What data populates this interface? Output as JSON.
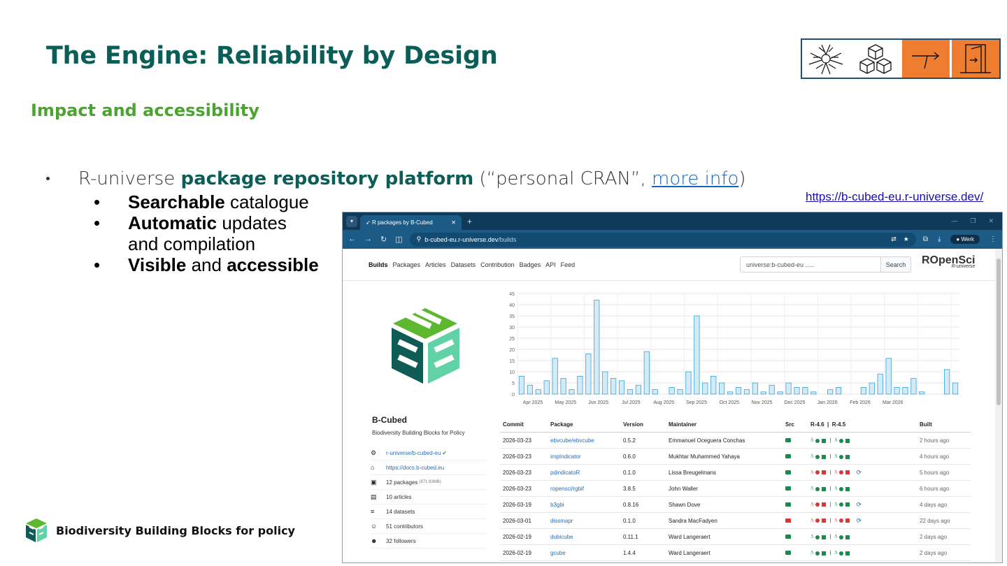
{
  "slide": {
    "title": "The Engine: Reliability by Design",
    "subtitle": "Impact and accessibility",
    "bullet_prefix": "R-universe ",
    "bullet_bold": "package repository platform",
    "bullet_mid": " (“personal CRAN”, ",
    "bullet_link": "more info",
    "bullet_suffix": ")",
    "sub_bullets": [
      {
        "bold": "Searchable",
        "rest": " catalogue"
      },
      {
        "bold": "Automatic",
        "rest": " updates"
      },
      {
        "bold": "",
        "rest": "and compilation"
      },
      {
        "bold": "Visible",
        "rest": " and ",
        "bold2": "accessible"
      }
    ],
    "url": "https://b-cubed-eu.r-universe.dev/",
    "footer": "Biodiversity Building Blocks for policy"
  },
  "browser": {
    "tab_title": "R packages by B-Cubed",
    "url_host": "b-cubed-eu.r-universe.dev",
    "url_path": "/builds",
    "profile": "Werk",
    "nav": [
      "Builds",
      "Packages",
      "Articles",
      "Datasets",
      "Contribution",
      "Badges",
      "API",
      "Feed"
    ],
    "search_value": "universe:b-cubed-eu .....",
    "search_button": "Search",
    "brand": "ROpenSci",
    "brand_sub": "R-universe"
  },
  "profile": {
    "name": "B-Cubed",
    "description": "Biodiversity Building Blocks for Policy",
    "items": [
      {
        "icon": "github-icon",
        "glyph": "⚙",
        "text": "r-universe/b-cubed-eu",
        "extra": "✔",
        "link": true
      },
      {
        "icon": "home-icon",
        "glyph": "⌂",
        "text": "https://docs.b-cubed.eu",
        "link": true
      },
      {
        "icon": "packages-icon",
        "glyph": "▣",
        "text": "12 packages",
        "small": "(871.93MB)"
      },
      {
        "icon": "articles-icon",
        "glyph": "▤",
        "text": "10 articles"
      },
      {
        "icon": "datasets-icon",
        "glyph": "≡",
        "text": "14 datasets"
      },
      {
        "icon": "contributors-icon",
        "glyph": "☺",
        "text": "51 contributors"
      },
      {
        "icon": "followers-icon",
        "glyph": "☻",
        "text": "32 followers"
      }
    ]
  },
  "chart_data": {
    "type": "bar",
    "ylim": [
      0,
      45
    ],
    "yticks": [
      0,
      5,
      10,
      15,
      20,
      25,
      30,
      35,
      40,
      45
    ],
    "xtick_labels": [
      "Apr 2025",
      "May 2025",
      "Jun 2025",
      "Jul 2025",
      "Aug 2025",
      "Sep 2025",
      "Oct 2025",
      "Nov 2025",
      "Dec 2025",
      "Jan 2026",
      "Feb 2026",
      "Mar 2026"
    ],
    "values": [
      8,
      4,
      2,
      6,
      16,
      7,
      2,
      8,
      18,
      42,
      10,
      7,
      6,
      2,
      4,
      19,
      2,
      0,
      3,
      2,
      10,
      35,
      5,
      8,
      5,
      1,
      3,
      2,
      5,
      1,
      4,
      1,
      5,
      3,
      3,
      1,
      0,
      2,
      3,
      0,
      0,
      3,
      5,
      9,
      16,
      3,
      3,
      7,
      1,
      0,
      0,
      11,
      5
    ],
    "color": "#d3ebf7",
    "stroke": "#3aa0d5",
    "grid": true
  },
  "builds": {
    "headers": [
      "Commit",
      "Package",
      "Version",
      "Maintainer",
      "Src",
      "R-4.6  |  R-4.5",
      "Built"
    ],
    "rows": [
      {
        "commit": "2026-03-23",
        "package": "ebvcube/ebvcube",
        "version": "0.5.2",
        "maintainer": "Emmanuel Oceguera Conchas",
        "built": "2 hours ago",
        "src_fail": false,
        "fail": false,
        "sync": false
      },
      {
        "commit": "2026-03-23",
        "package": "impIndicator",
        "version": "0.6.0",
        "maintainer": "Mukhtar Muhammed Yahaya",
        "built": "4 hours ago",
        "src_fail": false,
        "fail": false,
        "sync": false
      },
      {
        "commit": "2026-03-23",
        "package": "pdindicatoR",
        "version": "0.1.0",
        "maintainer": "Lissa Breugelmans",
        "built": "5 hours ago",
        "src_fail": false,
        "fail": true,
        "sync": true
      },
      {
        "commit": "2026-03-23",
        "package": "ropensci/rgbif",
        "version": "3.8.5",
        "maintainer": "John Waller",
        "built": "6 hours ago",
        "src_fail": false,
        "fail": false,
        "sync": false
      },
      {
        "commit": "2026-03-19",
        "package": "b3gbi",
        "version": "0.8.16",
        "maintainer": "Shawn Dove",
        "built": "4 days ago",
        "src_fail": false,
        "fail": "mixed",
        "sync": true
      },
      {
        "commit": "2026-03-01",
        "package": "dissmapr",
        "version": "0.1.0",
        "maintainer": "Sandra MacFadyen",
        "built": "22 days ago",
        "src_fail": true,
        "fail": true,
        "sync": true
      },
      {
        "commit": "2026-02-19",
        "package": "dubicube",
        "version": "0.11.1",
        "maintainer": "Ward Langeraert",
        "built": "2 days ago",
        "src_fail": false,
        "fail": false,
        "sync": false
      },
      {
        "commit": "2026-02-19",
        "package": "gcube",
        "version": "1.4.4",
        "maintainer": "Ward Langeraert",
        "built": "2 days ago",
        "src_fail": false,
        "fail": false,
        "sync": false
      }
    ]
  },
  "colors": {
    "title": "#0b5d57",
    "subtitle": "#4aa52e",
    "accent_orange": "#ef7d2f",
    "browser_dark": "#0f3a5a"
  }
}
